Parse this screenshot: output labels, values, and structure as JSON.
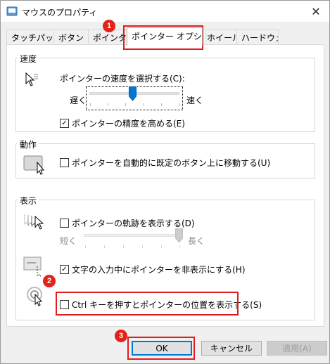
{
  "window": {
    "title": "マウスのプロパティ",
    "close_symbol": "✕"
  },
  "tabs": [
    {
      "label": "タッチパッド",
      "active": false
    },
    {
      "label": "ボタン",
      "active": false
    },
    {
      "label": "ポインター",
      "active": false
    },
    {
      "label": "ポインター オプション",
      "active": true
    },
    {
      "label": "ホイール",
      "active": false
    },
    {
      "label": "ハードウェア",
      "active": false
    }
  ],
  "speed": {
    "group_label": "速度",
    "prompt": "ポインターの速度を選択する(C):",
    "slow": "遅く",
    "fast": "速く",
    "value_fraction": 0.5,
    "precision_label": "ポインターの精度を高める(E)",
    "precision_checked": true
  },
  "snap": {
    "group_label": "動作",
    "label": "ポインターを自動的に既定のボタン上に移動する(U)",
    "checked": false
  },
  "visibility": {
    "group_label": "表示",
    "trails_label": "ポインターの軌跡を表示する(D)",
    "trails_checked": false,
    "short": "短く",
    "long": "長く",
    "trail_value_fraction": 1.0,
    "hide_label": "文字の入力中にポインターを非表示にする(H)",
    "hide_checked": true,
    "ctrl_label": "Ctrl キーを押すとポインターの位置を表示する(S)",
    "ctrl_checked": false
  },
  "buttons": {
    "ok": "OK",
    "cancel": "キャンセル",
    "apply": "適用(A)"
  },
  "badges": [
    "1",
    "2",
    "3"
  ],
  "check_mark": "✓",
  "colors": {
    "highlight": "#e01d1d",
    "badge": "#e2231a",
    "focus": "#0078d7"
  }
}
